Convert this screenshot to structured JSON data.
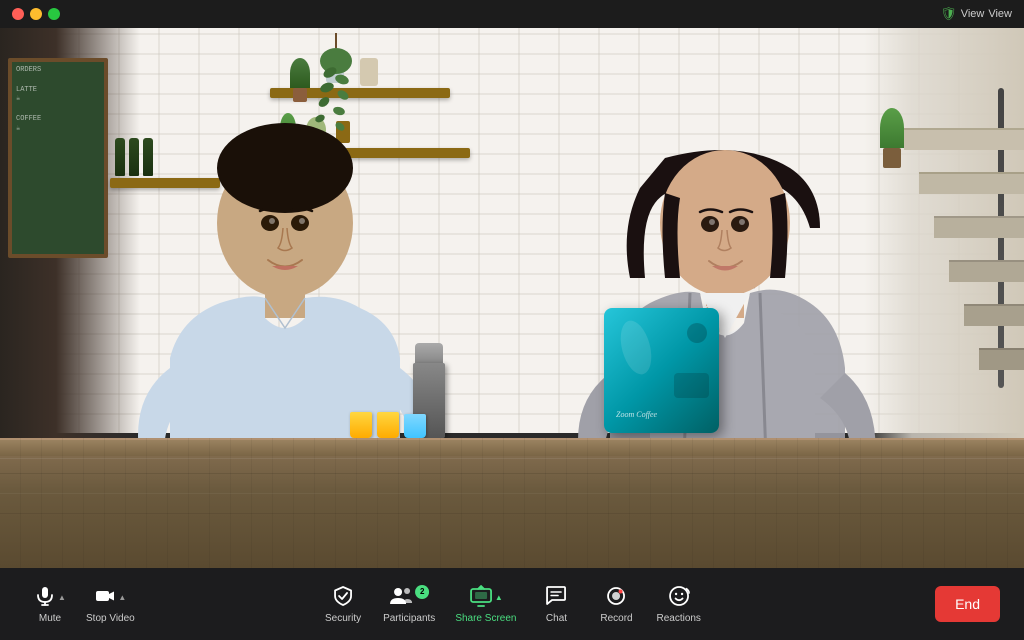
{
  "titleBar": {
    "view_label": "View",
    "shield_icon": "🛡"
  },
  "toolbar": {
    "mute_label": "Mute",
    "stop_video_label": "Stop Video",
    "security_label": "Security",
    "participants_label": "Participants",
    "participants_count": "2",
    "share_screen_label": "Share Screen",
    "chat_label": "Chat",
    "record_label": "Record",
    "reactions_label": "Reactions",
    "end_label": "End"
  },
  "video": {
    "background": "cafe scene with two people"
  }
}
